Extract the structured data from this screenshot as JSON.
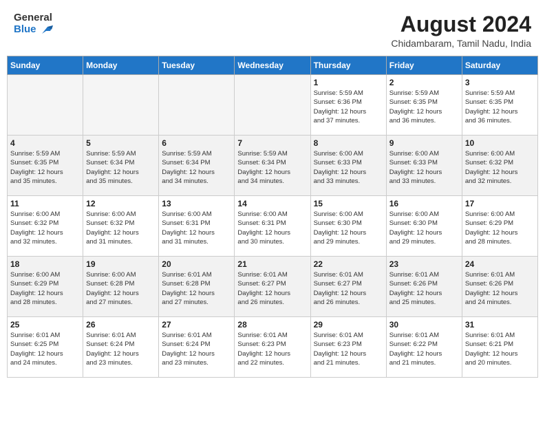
{
  "header": {
    "logo_general": "General",
    "logo_blue": "Blue",
    "month_year": "August 2024",
    "location": "Chidambaram, Tamil Nadu, India"
  },
  "weekdays": [
    "Sunday",
    "Monday",
    "Tuesday",
    "Wednesday",
    "Thursday",
    "Friday",
    "Saturday"
  ],
  "weeks": [
    {
      "shaded": false,
      "days": [
        {
          "date": "",
          "info": ""
        },
        {
          "date": "",
          "info": ""
        },
        {
          "date": "",
          "info": ""
        },
        {
          "date": "",
          "info": ""
        },
        {
          "date": "1",
          "info": "Sunrise: 5:59 AM\nSunset: 6:36 PM\nDaylight: 12 hours\nand 37 minutes."
        },
        {
          "date": "2",
          "info": "Sunrise: 5:59 AM\nSunset: 6:35 PM\nDaylight: 12 hours\nand 36 minutes."
        },
        {
          "date": "3",
          "info": "Sunrise: 5:59 AM\nSunset: 6:35 PM\nDaylight: 12 hours\nand 36 minutes."
        }
      ]
    },
    {
      "shaded": true,
      "days": [
        {
          "date": "4",
          "info": "Sunrise: 5:59 AM\nSunset: 6:35 PM\nDaylight: 12 hours\nand 35 minutes."
        },
        {
          "date": "5",
          "info": "Sunrise: 5:59 AM\nSunset: 6:34 PM\nDaylight: 12 hours\nand 35 minutes."
        },
        {
          "date": "6",
          "info": "Sunrise: 5:59 AM\nSunset: 6:34 PM\nDaylight: 12 hours\nand 34 minutes."
        },
        {
          "date": "7",
          "info": "Sunrise: 5:59 AM\nSunset: 6:34 PM\nDaylight: 12 hours\nand 34 minutes."
        },
        {
          "date": "8",
          "info": "Sunrise: 6:00 AM\nSunset: 6:33 PM\nDaylight: 12 hours\nand 33 minutes."
        },
        {
          "date": "9",
          "info": "Sunrise: 6:00 AM\nSunset: 6:33 PM\nDaylight: 12 hours\nand 33 minutes."
        },
        {
          "date": "10",
          "info": "Sunrise: 6:00 AM\nSunset: 6:32 PM\nDaylight: 12 hours\nand 32 minutes."
        }
      ]
    },
    {
      "shaded": false,
      "days": [
        {
          "date": "11",
          "info": "Sunrise: 6:00 AM\nSunset: 6:32 PM\nDaylight: 12 hours\nand 32 minutes."
        },
        {
          "date": "12",
          "info": "Sunrise: 6:00 AM\nSunset: 6:32 PM\nDaylight: 12 hours\nand 31 minutes."
        },
        {
          "date": "13",
          "info": "Sunrise: 6:00 AM\nSunset: 6:31 PM\nDaylight: 12 hours\nand 31 minutes."
        },
        {
          "date": "14",
          "info": "Sunrise: 6:00 AM\nSunset: 6:31 PM\nDaylight: 12 hours\nand 30 minutes."
        },
        {
          "date": "15",
          "info": "Sunrise: 6:00 AM\nSunset: 6:30 PM\nDaylight: 12 hours\nand 29 minutes."
        },
        {
          "date": "16",
          "info": "Sunrise: 6:00 AM\nSunset: 6:30 PM\nDaylight: 12 hours\nand 29 minutes."
        },
        {
          "date": "17",
          "info": "Sunrise: 6:00 AM\nSunset: 6:29 PM\nDaylight: 12 hours\nand 28 minutes."
        }
      ]
    },
    {
      "shaded": true,
      "days": [
        {
          "date": "18",
          "info": "Sunrise: 6:00 AM\nSunset: 6:29 PM\nDaylight: 12 hours\nand 28 minutes."
        },
        {
          "date": "19",
          "info": "Sunrise: 6:00 AM\nSunset: 6:28 PM\nDaylight: 12 hours\nand 27 minutes."
        },
        {
          "date": "20",
          "info": "Sunrise: 6:01 AM\nSunset: 6:28 PM\nDaylight: 12 hours\nand 27 minutes."
        },
        {
          "date": "21",
          "info": "Sunrise: 6:01 AM\nSunset: 6:27 PM\nDaylight: 12 hours\nand 26 minutes."
        },
        {
          "date": "22",
          "info": "Sunrise: 6:01 AM\nSunset: 6:27 PM\nDaylight: 12 hours\nand 26 minutes."
        },
        {
          "date": "23",
          "info": "Sunrise: 6:01 AM\nSunset: 6:26 PM\nDaylight: 12 hours\nand 25 minutes."
        },
        {
          "date": "24",
          "info": "Sunrise: 6:01 AM\nSunset: 6:26 PM\nDaylight: 12 hours\nand 24 minutes."
        }
      ]
    },
    {
      "shaded": false,
      "days": [
        {
          "date": "25",
          "info": "Sunrise: 6:01 AM\nSunset: 6:25 PM\nDaylight: 12 hours\nand 24 minutes."
        },
        {
          "date": "26",
          "info": "Sunrise: 6:01 AM\nSunset: 6:24 PM\nDaylight: 12 hours\nand 23 minutes."
        },
        {
          "date": "27",
          "info": "Sunrise: 6:01 AM\nSunset: 6:24 PM\nDaylight: 12 hours\nand 23 minutes."
        },
        {
          "date": "28",
          "info": "Sunrise: 6:01 AM\nSunset: 6:23 PM\nDaylight: 12 hours\nand 22 minutes."
        },
        {
          "date": "29",
          "info": "Sunrise: 6:01 AM\nSunset: 6:23 PM\nDaylight: 12 hours\nand 21 minutes."
        },
        {
          "date": "30",
          "info": "Sunrise: 6:01 AM\nSunset: 6:22 PM\nDaylight: 12 hours\nand 21 minutes."
        },
        {
          "date": "31",
          "info": "Sunrise: 6:01 AM\nSunset: 6:21 PM\nDaylight: 12 hours\nand 20 minutes."
        }
      ]
    }
  ]
}
